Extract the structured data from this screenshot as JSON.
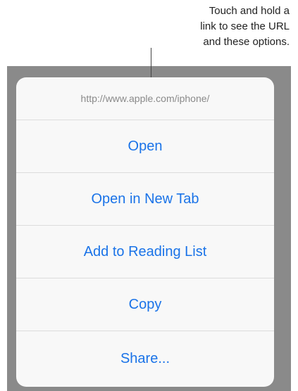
{
  "callout": {
    "lines": [
      "Touch and hold a",
      "link to see the URL",
      "and these options."
    ]
  },
  "sheet": {
    "url": "http://www.apple.com/iphone/",
    "actions": [
      {
        "label": "Open"
      },
      {
        "label": "Open in New Tab"
      },
      {
        "label": "Add to Reading List"
      },
      {
        "label": "Copy"
      },
      {
        "label": "Share..."
      }
    ]
  },
  "colors": {
    "action_text": "#1a73e8",
    "url_text": "#8a8a8a",
    "backdrop": "#8a8a8a",
    "sheet_bg": "#f8f8f8"
  }
}
